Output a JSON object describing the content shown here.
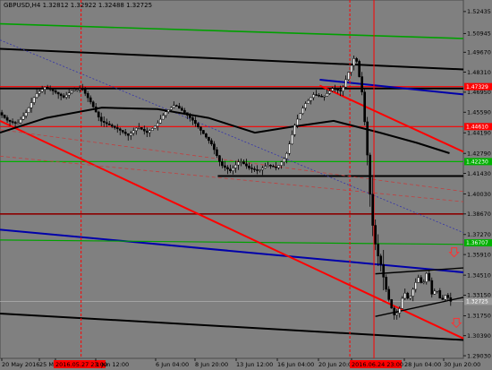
{
  "chart_data": {
    "type": "candlestick",
    "title": "GBPUSD,H4 1.32812 1.32922 1.32488 1.32725",
    "symbol": "GBPUSD",
    "timeframe": "H4",
    "ohlc": {
      "open": 1.32812,
      "high": 1.32922,
      "low": 1.32488,
      "close": 1.32725
    },
    "y_range": [
      1.2885,
      1.5322
    ],
    "price_ticks": [
      "1.52435",
      "1.50945",
      "1.49670",
      "1.48310",
      "1.46950",
      "1.45590",
      "1.44190",
      "1.42790",
      "1.41430",
      "1.40030",
      "1.38670",
      "1.37270",
      "1.35910",
      "1.34510",
      "1.33150",
      "1.31750",
      "1.30390",
      "1.29030"
    ],
    "x_labels": [
      "20 May 2016",
      "25 May",
      "2016.05.27 23:00",
      "1 Jun 12:00",
      "6 Jun 04:00",
      "8 Jun 20:00",
      "13 Jun 12:00",
      "16 Jun 04:00",
      "20 Jun 20:00",
      "2016.06.24 23:00",
      "28 Jun 04:00",
      "30 Jun 20:00"
    ],
    "level_labels": [
      {
        "text": "1.47329",
        "price": 1.47329,
        "color": "#ff0000"
      },
      {
        "text": "1.44610",
        "price": 1.4461,
        "color": "#ff0000"
      },
      {
        "text": "1.42230",
        "price": 1.4223,
        "color": "#00b000"
      },
      {
        "text": "1.36707",
        "price": 1.36707,
        "color": "#00b000"
      },
      {
        "text": "1.32725",
        "price": 1.32725,
        "color": "#9a9a9a"
      }
    ],
    "horizontal_levels": [
      {
        "price": 1.47329,
        "color": "#ff0000",
        "width": 1.2,
        "from": 0.0
      },
      {
        "price": 1.4461,
        "color": "#ff0000",
        "width": 1.2,
        "from": 0.0
      },
      {
        "price": 1.4223,
        "color": "#00b000",
        "width": 1.2,
        "from": 0.0
      },
      {
        "price": 1.3867,
        "color": "#8b0000",
        "width": 1.6,
        "from": 0.0
      },
      {
        "price": 1.472,
        "color": "#000000",
        "width": 2.0,
        "from": 0.0
      },
      {
        "price": 1.4125,
        "color": "#000000",
        "width": 2.0,
        "from": 0.47
      },
      {
        "price": 1.32725,
        "color": "#b0b0b0",
        "width": 0.8,
        "from": 0.0
      }
    ],
    "trend_lines": [
      {
        "x1": 0.0,
        "p1": 1.516,
        "x2": 1.0,
        "p2": 1.506,
        "color": "#00a000",
        "width": 1.6,
        "dash": ""
      },
      {
        "x1": 0.0,
        "p1": 1.499,
        "x2": 1.0,
        "p2": 1.485,
        "color": "#000000",
        "width": 2.0,
        "dash": ""
      },
      {
        "x1": 0.0,
        "p1": 1.376,
        "x2": 1.0,
        "p2": 1.347,
        "color": "#0000aa",
        "width": 2.0,
        "dash": ""
      },
      {
        "x1": 0.0,
        "p1": 1.319,
        "x2": 1.0,
        "p2": 1.301,
        "color": "#000000",
        "width": 2.0,
        "dash": ""
      },
      {
        "x1": 0.0,
        "p1": 1.369,
        "x2": 1.0,
        "p2": 1.366,
        "color": "#00a000",
        "width": 1.2,
        "dash": ""
      },
      {
        "x1": 0.0,
        "p1": 1.45,
        "x2": 1.0,
        "p2": 1.302,
        "color": "#ff0000",
        "width": 2.0,
        "dash": ""
      },
      {
        "x1": 0.0,
        "p1": 1.505,
        "x2": 1.0,
        "p2": 1.374,
        "color": "#3333aa",
        "width": 0.8,
        "dash": "2,2"
      },
      {
        "x1": 0.0,
        "p1": 1.444,
        "x2": 1.0,
        "p2": 1.402,
        "color": "#c04040",
        "width": 0.8,
        "dash": "4,3"
      },
      {
        "x1": 0.0,
        "p1": 1.426,
        "x2": 1.0,
        "p2": 1.395,
        "color": "#c04040",
        "width": 0.8,
        "dash": "4,3"
      },
      {
        "x1": 0.69,
        "p1": 1.478,
        "x2": 1.0,
        "p2": 1.468,
        "color": "#0000aa",
        "width": 2.0,
        "dash": ""
      },
      {
        "x1": 0.69,
        "p1": 1.474,
        "x2": 1.0,
        "p2": 1.429,
        "color": "#ff0000",
        "width": 2.0,
        "dash": ""
      },
      {
        "x1": 0.81,
        "p1": 1.346,
        "x2": 1.0,
        "p2": 1.35,
        "color": "#000000",
        "width": 1.4,
        "dash": ""
      },
      {
        "x1": 0.81,
        "p1": 1.317,
        "x2": 1.0,
        "p2": 1.33,
        "color": "#000000",
        "width": 1.4,
        "dash": ""
      }
    ],
    "curves": [
      {
        "color": "#000000",
        "width": 2.0,
        "points": [
          [
            0.0,
            1.442
          ],
          [
            0.1,
            1.452
          ],
          [
            0.22,
            1.459
          ],
          [
            0.34,
            1.458
          ],
          [
            0.45,
            1.452
          ],
          [
            0.55,
            1.442
          ],
          [
            0.63,
            1.446
          ],
          [
            0.72,
            1.45
          ],
          [
            0.82,
            1.442
          ],
          [
            0.9,
            1.435
          ],
          [
            0.97,
            1.428
          ]
        ]
      }
    ],
    "vertical_markers": [
      {
        "x": 0.175,
        "color": "#ff0000",
        "dash": "3,2"
      },
      {
        "x": 0.755,
        "color": "#ff0000",
        "dash": "3,2"
      },
      {
        "x": 0.807,
        "color": "#ff0000",
        "dash": ""
      }
    ],
    "arrows": [
      {
        "x": 0.98,
        "price": 1.36,
        "color": "#ff3030",
        "dir": "down"
      },
      {
        "x": 0.985,
        "price": 1.312,
        "color": "#ff3030",
        "dir": "down"
      }
    ],
    "price_path": [
      [
        0.0,
        1.456
      ],
      [
        0.02,
        1.45
      ],
      [
        0.04,
        1.448
      ],
      [
        0.06,
        1.456
      ],
      [
        0.08,
        1.468
      ],
      [
        0.1,
        1.473
      ],
      [
        0.12,
        1.47
      ],
      [
        0.14,
        1.466
      ],
      [
        0.16,
        1.471
      ],
      [
        0.18,
        1.472
      ],
      [
        0.2,
        1.462
      ],
      [
        0.22,
        1.45
      ],
      [
        0.24,
        1.447
      ],
      [
        0.26,
        1.444
      ],
      [
        0.28,
        1.44
      ],
      [
        0.3,
        1.446
      ],
      [
        0.32,
        1.442
      ],
      [
        0.34,
        1.447
      ],
      [
        0.36,
        1.456
      ],
      [
        0.38,
        1.461
      ],
      [
        0.4,
        1.456
      ],
      [
        0.42,
        1.45
      ],
      [
        0.44,
        1.442
      ],
      [
        0.46,
        1.434
      ],
      [
        0.48,
        1.42
      ],
      [
        0.5,
        1.416
      ],
      [
        0.52,
        1.423
      ],
      [
        0.54,
        1.418
      ],
      [
        0.56,
        1.416
      ],
      [
        0.58,
        1.42
      ],
      [
        0.6,
        1.418
      ],
      [
        0.62,
        1.426
      ],
      [
        0.64,
        1.448
      ],
      [
        0.66,
        1.461
      ],
      [
        0.68,
        1.468
      ],
      [
        0.7,
        1.466
      ],
      [
        0.72,
        1.472
      ],
      [
        0.74,
        1.47
      ],
      [
        0.755,
        1.483
      ],
      [
        0.77,
        1.495
      ],
      [
        0.785,
        1.468
      ],
      [
        0.795,
        1.43
      ],
      [
        0.805,
        1.384
      ],
      [
        0.815,
        1.362
      ],
      [
        0.825,
        1.352
      ],
      [
        0.835,
        1.337
      ],
      [
        0.845,
        1.325
      ],
      [
        0.855,
        1.317
      ],
      [
        0.865,
        1.322
      ],
      [
        0.875,
        1.334
      ],
      [
        0.885,
        1.328
      ],
      [
        0.895,
        1.336
      ],
      [
        0.905,
        1.344
      ],
      [
        0.915,
        1.338
      ],
      [
        0.925,
        1.348
      ],
      [
        0.935,
        1.332
      ],
      [
        0.945,
        1.336
      ],
      [
        0.955,
        1.327
      ],
      [
        0.965,
        1.332
      ],
      [
        0.975,
        1.32725
      ]
    ]
  }
}
